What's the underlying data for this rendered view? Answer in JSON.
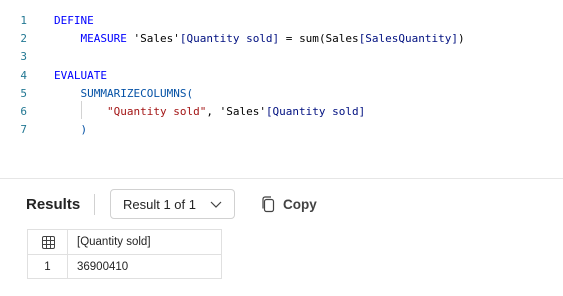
{
  "editor": {
    "lines": [
      {
        "num": "1",
        "tokens": [
          {
            "t": "DEFINE",
            "c": "kw"
          }
        ]
      },
      {
        "num": "2",
        "tokens": [
          {
            "t": "    MEASURE ",
            "c": "kw"
          },
          {
            "t": "'Sales'",
            "c": "plain"
          },
          {
            "t": "[Quantity sold]",
            "c": "ref"
          },
          {
            "t": " = ",
            "c": "plain"
          },
          {
            "t": "sum",
            "c": "plain"
          },
          {
            "t": "(Sales",
            "c": "plain"
          },
          {
            "t": "[SalesQuantity]",
            "c": "ref"
          },
          {
            "t": ")",
            "c": "plain"
          }
        ]
      },
      {
        "num": "3",
        "tokens": []
      },
      {
        "num": "4",
        "tokens": [
          {
            "t": "EVALUATE",
            "c": "kw"
          }
        ]
      },
      {
        "num": "5",
        "tokens": [
          {
            "t": "    SUMMARIZECOLUMNS(",
            "c": "fn-blue"
          }
        ]
      },
      {
        "num": "6",
        "tokens": [
          {
            "t": "        ",
            "c": "plain"
          },
          {
            "t": "\"Quantity sold\"",
            "c": "str"
          },
          {
            "t": ", ",
            "c": "plain"
          },
          {
            "t": "'Sales'",
            "c": "plain"
          },
          {
            "t": "[Quantity sold]",
            "c": "ref"
          }
        ]
      },
      {
        "num": "7",
        "tokens": [
          {
            "t": "    )",
            "c": "fn-blue"
          }
        ]
      }
    ]
  },
  "results": {
    "title": "Results",
    "selector_label": "Result 1 of 1",
    "copy_label": "Copy",
    "grid": {
      "header": "[Quantity sold]",
      "rows": [
        {
          "index": "1",
          "value": "36900410"
        }
      ]
    }
  },
  "colors": {
    "keyword": "#0000ff",
    "line_number": "#237893",
    "string": "#a31515"
  }
}
